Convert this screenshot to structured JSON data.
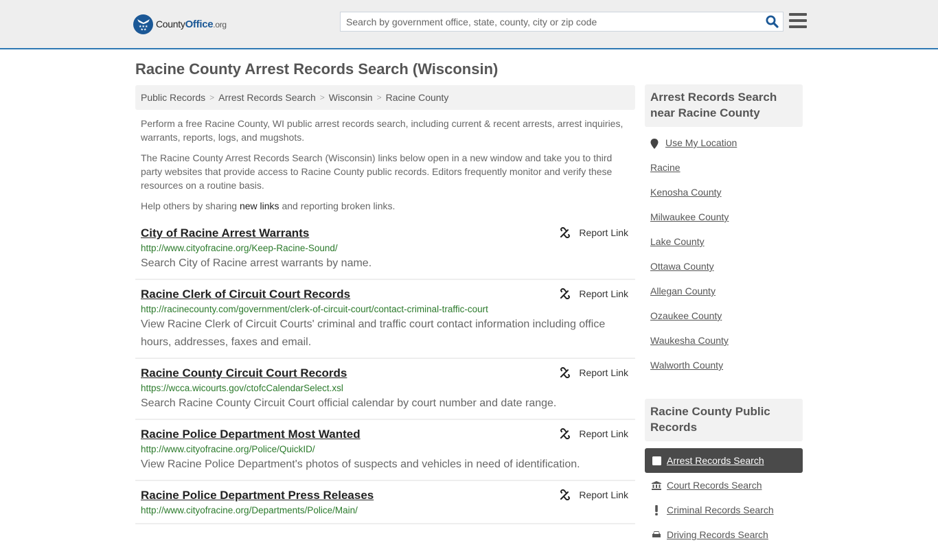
{
  "header": {
    "logo": {
      "county": "County",
      "office": "Office",
      "org": ".org"
    },
    "search": {
      "placeholder": "Search by government office, state, county, city or zip code",
      "value": ""
    },
    "icons": {
      "search": "search-icon",
      "menu": "hamburger-menu-icon"
    }
  },
  "page": {
    "title": "Racine County Arrest Records Search (Wisconsin)"
  },
  "breadcrumb": [
    {
      "label": "Public Records"
    },
    {
      "label": "Arrest Records Search"
    },
    {
      "label": "Wisconsin"
    },
    {
      "label": "Racine County"
    }
  ],
  "intro": {
    "p1": "Perform a free Racine County, WI public arrest records search, including current & recent arrests, arrest inquiries, warrants, reports, logs, and mugshots.",
    "p2": "The Racine County Arrest Records Search (Wisconsin) links below open in a new window and take you to third party websites that provide access to Racine County public records. Editors frequently monitor and verify these resources on a routine basis.",
    "p3_before": "Help others by sharing ",
    "p3_link": "new links",
    "p3_after": " and reporting broken links."
  },
  "results": [
    {
      "title": "City of Racine Arrest Warrants",
      "url": "http://www.cityofracine.org/Keep-Racine-Sound/",
      "description": "Search City of Racine arrest warrants by name.",
      "report_label": "Report Link"
    },
    {
      "title": "Racine Clerk of Circuit Court Records",
      "url": "http://racinecounty.com/government/clerk-of-circuit-court/contact-criminal-traffic-court",
      "description": "View Racine Clerk of Circuit Courts' criminal and traffic court contact information including office hours, addresses, faxes and email.",
      "report_label": "Report Link"
    },
    {
      "title": "Racine County Circuit Court Records",
      "url": "https://wcca.wicourts.gov/ctofcCalendarSelect.xsl",
      "description": "Search Racine County Circuit Court official calendar by court number and date range.",
      "report_label": "Report Link"
    },
    {
      "title": "Racine Police Department Most Wanted",
      "url": "http://www.cityofracine.org/Police/QuickID/",
      "description": "View Racine Police Department's photos of suspects and vehicles in need of identification.",
      "report_label": "Report Link"
    },
    {
      "title": "Racine Police Department Press Releases",
      "url": "http://www.cityofracine.org/Departments/Police/Main/",
      "description": "",
      "report_label": "Report Link"
    }
  ],
  "sidebar": {
    "near_heading": "Arrest Records Search near Racine County",
    "use_location": "Use My Location",
    "near_items": [
      "Racine",
      "Kenosha County",
      "Milwaukee County",
      "Lake County",
      "Ottawa County",
      "Allegan County",
      "Ozaukee County",
      "Waukesha County",
      "Walworth County"
    ],
    "records_heading": "Racine County Public Records",
    "records_items": [
      {
        "label": "Arrest Records Search",
        "icon": "square-icon",
        "active": true
      },
      {
        "label": "Court Records Search",
        "icon": "courthouse-icon",
        "active": false
      },
      {
        "label": "Criminal Records Search",
        "icon": "exclamation-icon",
        "active": false
      },
      {
        "label": "Driving Records Search",
        "icon": "car-icon",
        "active": false
      }
    ]
  },
  "colors": {
    "header_bg": "#eeeeee",
    "header_border": "#2e78b4",
    "brand_blue": "#1b5896",
    "url_green": "#2b7a2b",
    "active_item_bg": "#4a4a4a"
  }
}
